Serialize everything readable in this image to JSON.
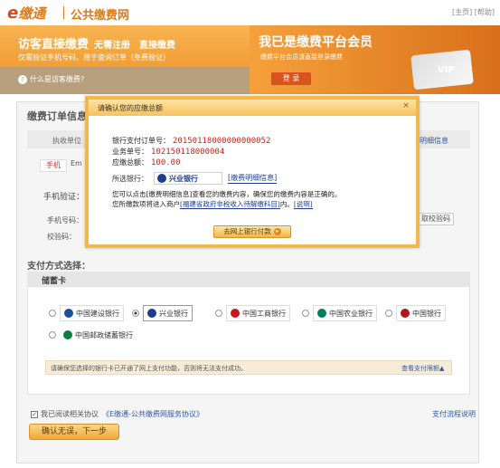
{
  "header": {
    "logo_e": "e",
    "logo_text": "缴通",
    "site_name": "公共缴费网",
    "top_links": "[主页] [帮助]"
  },
  "banner": {
    "left_title": "访客直接缴费",
    "left_sub": "无需注册　直接缴费",
    "left_desc": "仅需验证手机号码，用于查询订单（免费验证）",
    "visitor_link": "什么是访客缴费?",
    "right_title": "我已是缴费平台会员",
    "right_desc": "缴费平台会员请直接登录缴费",
    "login_label": "登 录",
    "vip_text": "VIP"
  },
  "order": {
    "title": "缴费订单信息",
    "exec_unit": "执收单位",
    "detail_link": "明细信息",
    "tab_mobile": "手机",
    "tab_email": "Em",
    "verify_label": "手机验证：",
    "phone_label": "手机号码：",
    "code_label": "校验码：",
    "get_code": "取校验码"
  },
  "payment": {
    "title": "支付方式选择：",
    "savings_tab": "储蓄卡",
    "banks": [
      {
        "name": "中国建设银行",
        "color": "#1a4f9c",
        "selected": false
      },
      {
        "name": "兴业银行",
        "color": "#1c3f8c",
        "selected": true
      },
      {
        "name": "中国工商银行",
        "color": "#c8161d",
        "selected": false
      },
      {
        "name": "中国农业银行",
        "color": "#00805f",
        "selected": false
      },
      {
        "name": "中国银行",
        "color": "#b0141c",
        "selected": false
      },
      {
        "name": "中国邮政储蓄银行",
        "color": "#0a7f3f",
        "selected": false
      }
    ],
    "warning": "请确保您选择的银行卡已开通了网上支付功能，否则将无法支付成功。",
    "view_limit": "查看支付限额▲"
  },
  "agreement": {
    "checkbox": "✓",
    "text": "我已阅读相关协议",
    "link": "《E缴通-公共缴费网服务协议》",
    "pay_guide": "支付流程说明",
    "next_button": "确认无误，下一步"
  },
  "modal": {
    "title": "请确认您的应缴总额",
    "close": "×",
    "order_no_label": "银行支付订单号：",
    "order_no": "20150118000000000052",
    "biz_no_label": "业务单号：",
    "biz_no": "102150118000004",
    "total_label": "应缴总额：",
    "total": "100.00",
    "bank_label": "所选银行：",
    "bank_name": "兴业银行",
    "detail_btn": "[缴费明细信息]",
    "notice1": "您可以点击[缴费明细信息]查看您的缴费内容，确保您的缴费内容是正确的。",
    "notice2_pre": "您所缴款项将进入商户",
    "notice2_merchant": "[福建省政府非税收入待解缴科目]",
    "notice2_mid": "内。",
    "notice2_link": "[说明]",
    "go_button": "去网上银行付款"
  }
}
